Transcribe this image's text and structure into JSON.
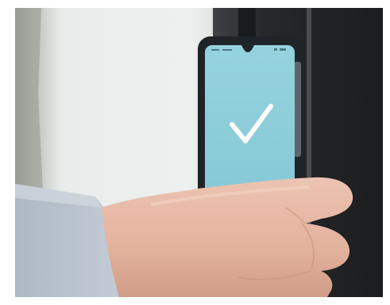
{
  "scene": {
    "description_keys": [
      "stucco-wall",
      "dark-door-frame",
      "smartphone",
      "hand"
    ],
    "colors": {
      "wall": "#e9ecea",
      "wall_shadow": "#9c9f98",
      "door": "#26292b",
      "door_edge": "#4a4d4f",
      "phone_body": "#1f2428",
      "phone_screen": "#8fd0dd",
      "checkmark": "#ffffff",
      "skin": "#e6b9a6",
      "skin_shadow": "#c99580",
      "sleeve": "#b9c2cd"
    },
    "phone": {
      "screen_state": "success",
      "icon": "checkmark-icon",
      "status_bar_text": "",
      "status_bar_icons": "status-bar-icons"
    }
  }
}
